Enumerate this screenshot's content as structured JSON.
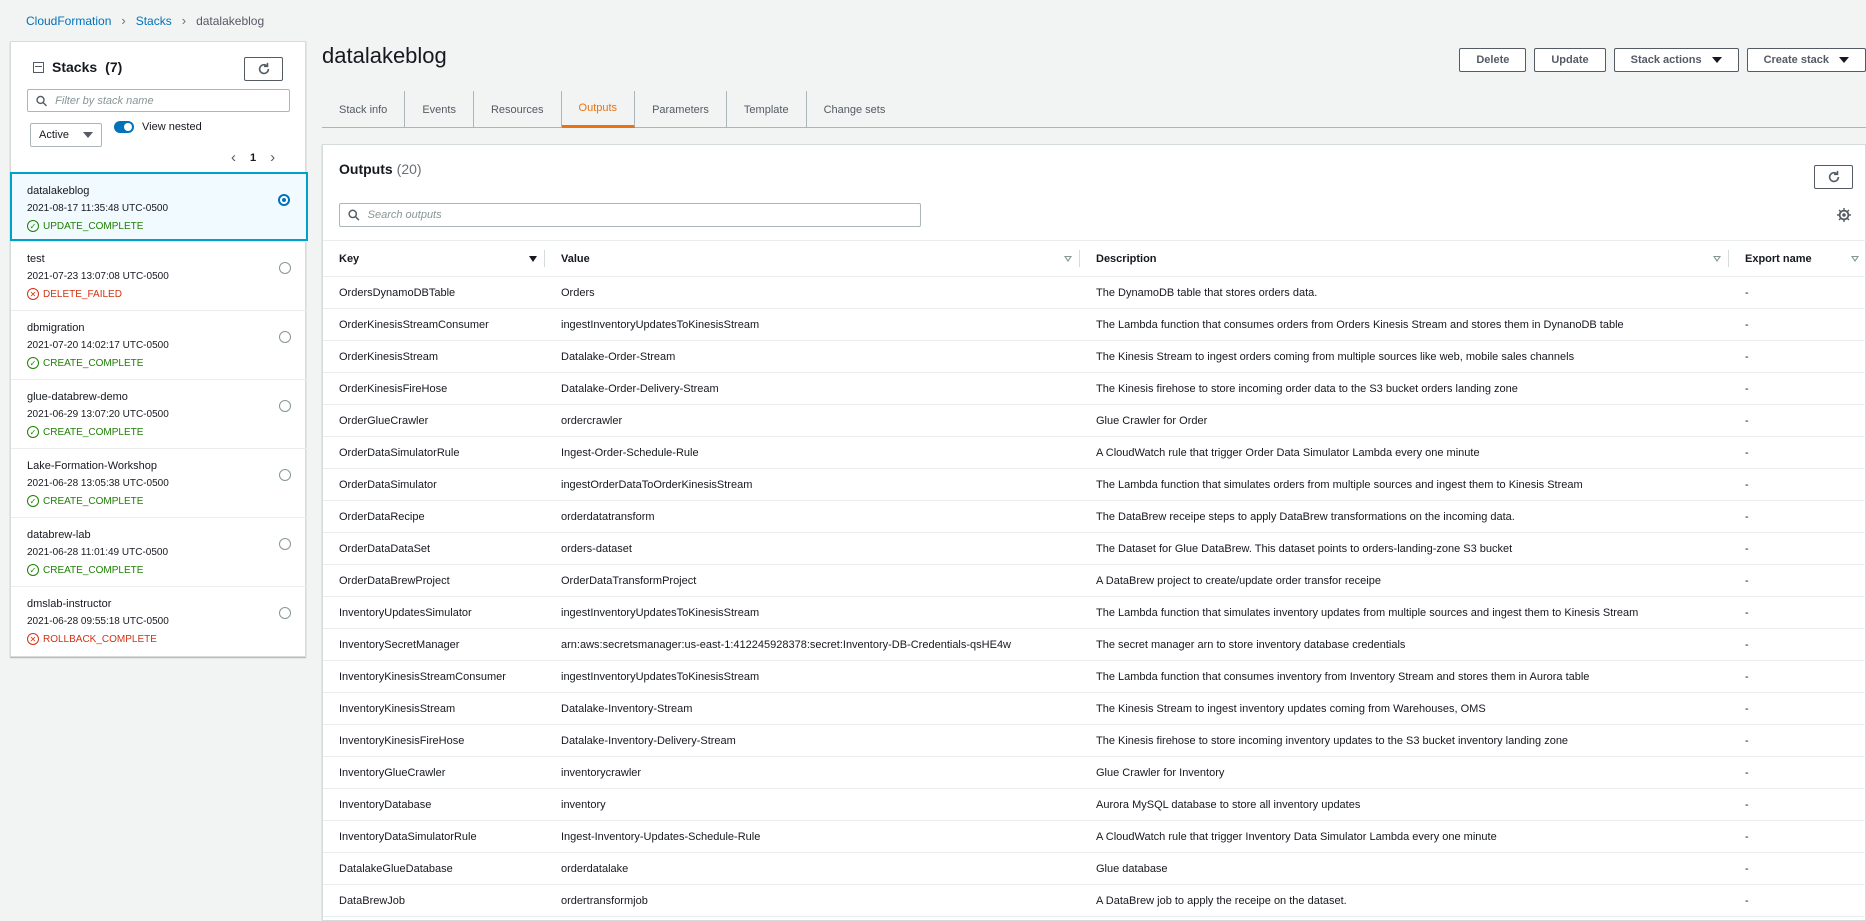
{
  "breadcrumb": {
    "root": "CloudFormation",
    "stacks": "Stacks",
    "current": "datalakeblog"
  },
  "sidebar": {
    "title": "Stacks",
    "count": "(7)",
    "filter_placeholder": "Filter by stack name",
    "status_filter": "Active",
    "view_nested_label": "View nested",
    "page": "1",
    "stacks": [
      {
        "name": "datalakeblog",
        "date": "2021-08-17 11:35:48 UTC-0500",
        "status": "UPDATE_COMPLETE"
      },
      {
        "name": "test",
        "date": "2021-07-23 13:07:08 UTC-0500",
        "status": "DELETE_FAILED"
      },
      {
        "name": "dbmigration",
        "date": "2021-07-20 14:02:17 UTC-0500",
        "status": "CREATE_COMPLETE"
      },
      {
        "name": "glue-databrew-demo",
        "date": "2021-06-29 13:07:20 UTC-0500",
        "status": "CREATE_COMPLETE"
      },
      {
        "name": "Lake-Formation-Workshop",
        "date": "2021-06-28 13:05:38 UTC-0500",
        "status": "CREATE_COMPLETE"
      },
      {
        "name": "databrew-lab",
        "date": "2021-06-28 11:01:49 UTC-0500",
        "status": "CREATE_COMPLETE"
      },
      {
        "name": "dmslab-instructor",
        "date": "2021-06-28 09:55:18 UTC-0500",
        "status": "ROLLBACK_COMPLETE"
      }
    ]
  },
  "header": {
    "title": "datalakeblog",
    "delete_label": "Delete",
    "update_label": "Update",
    "stack_actions_label": "Stack actions",
    "create_stack_label": "Create stack"
  },
  "tabs": [
    "Stack info",
    "Events",
    "Resources",
    "Outputs",
    "Parameters",
    "Template",
    "Change sets"
  ],
  "outputs": {
    "title": "Outputs",
    "count": "(20)",
    "search_placeholder": "Search outputs",
    "columns": [
      "Key",
      "Value",
      "Description",
      "Export name"
    ],
    "rows": [
      {
        "key": "OrdersDynamoDBTable",
        "value": "Orders",
        "description": "The DynamoDB table that stores orders data.",
        "export": "-"
      },
      {
        "key": "OrderKinesisStreamConsumer",
        "value": "ingestInventoryUpdatesToKinesisStream",
        "description": "The Lambda function that consumes orders from Orders Kinesis Stream and stores them in DynanoDB table",
        "export": "-"
      },
      {
        "key": "OrderKinesisStream",
        "value": "Datalake-Order-Stream",
        "description": "The Kinesis Stream to ingest orders coming from multiple sources like web, mobile sales channels",
        "export": "-"
      },
      {
        "key": "OrderKinesisFireHose",
        "value": "Datalake-Order-Delivery-Stream",
        "description": "The Kinesis firehose to store incoming order data to the S3 bucket orders landing zone",
        "export": "-"
      },
      {
        "key": "OrderGlueCrawler",
        "value": "ordercrawler",
        "description": "Glue Crawler for Order",
        "export": "-"
      },
      {
        "key": "OrderDataSimulatorRule",
        "value": "Ingest-Order-Schedule-Rule",
        "description": "A CloudWatch rule that trigger Order Data Simulator Lambda every one minute",
        "export": "-"
      },
      {
        "key": "OrderDataSimulator",
        "value": "ingestOrderDataToOrderKinesisStream",
        "description": "The Lambda function that simulates orders from multiple sources and ingest them to Kinesis Stream",
        "export": "-"
      },
      {
        "key": "OrderDataRecipe",
        "value": "orderdatatransform",
        "description": "The DataBrew receipe steps to apply DataBrew transformations on the incoming data.",
        "export": "-"
      },
      {
        "key": "OrderDataDataSet",
        "value": "orders-dataset",
        "description": "The Dataset for Glue DataBrew. This dataset points to orders-landing-zone S3 bucket",
        "export": "-"
      },
      {
        "key": "OrderDataBrewProject",
        "value": "OrderDataTransformProject",
        "description": "A DataBrew project to create/update order transfor receipe",
        "export": "-"
      },
      {
        "key": "InventoryUpdatesSimulator",
        "value": "ingestInventoryUpdatesToKinesisStream",
        "description": "The Lambda function that simulates inventory updates from multiple sources and ingest them to Kinesis Stream",
        "export": "-"
      },
      {
        "key": "InventorySecretManager",
        "value": "arn:aws:secretsmanager:us-east-1:412245928378:secret:Inventory-DB-Credentials-qsHE4w",
        "description": "The secret manager arn to store inventory database credentials",
        "export": "-"
      },
      {
        "key": "InventoryKinesisStreamConsumer",
        "value": "ingestInventoryUpdatesToKinesisStream",
        "description": "The Lambda function that consumes inventory from Inventory Stream and stores them in Aurora table",
        "export": "-"
      },
      {
        "key": "InventoryKinesisStream",
        "value": "Datalake-Inventory-Stream",
        "description": "The Kinesis Stream to ingest inventory updates coming from Warehouses, OMS",
        "export": "-"
      },
      {
        "key": "InventoryKinesisFireHose",
        "value": "Datalake-Inventory-Delivery-Stream",
        "description": "The Kinesis firehose to store incoming inventory updates to the S3 bucket inventory landing zone",
        "export": "-"
      },
      {
        "key": "InventoryGlueCrawler",
        "value": "inventorycrawler",
        "description": "Glue Crawler for Inventory",
        "export": "-"
      },
      {
        "key": "InventoryDatabase",
        "value": "inventory",
        "description": "Aurora MySQL database to store all inventory updates",
        "export": "-"
      },
      {
        "key": "InventoryDataSimulatorRule",
        "value": "Ingest-Inventory-Updates-Schedule-Rule",
        "description": "A CloudWatch rule that trigger Inventory Data Simulator Lambda every one minute",
        "export": "-"
      },
      {
        "key": "DatalakeGlueDatabase",
        "value": "orderdatalake",
        "description": "Glue database",
        "export": "-"
      },
      {
        "key": "DataBrewJob",
        "value": "ordertransformjob",
        "description": "A DataBrew job to apply the receipe on the dataset.",
        "export": "-"
      }
    ]
  },
  "colors": {
    "accent": "#ec7211",
    "link": "#0073bb",
    "success": "#1d8102",
    "error": "#d13212",
    "selected_border": "#00a1c9"
  },
  "icons": {
    "search": "search-icon",
    "refresh": "refresh-icon",
    "settings": "gear-icon",
    "status_ok": "check-circle-icon",
    "status_fail": "x-circle-icon"
  }
}
